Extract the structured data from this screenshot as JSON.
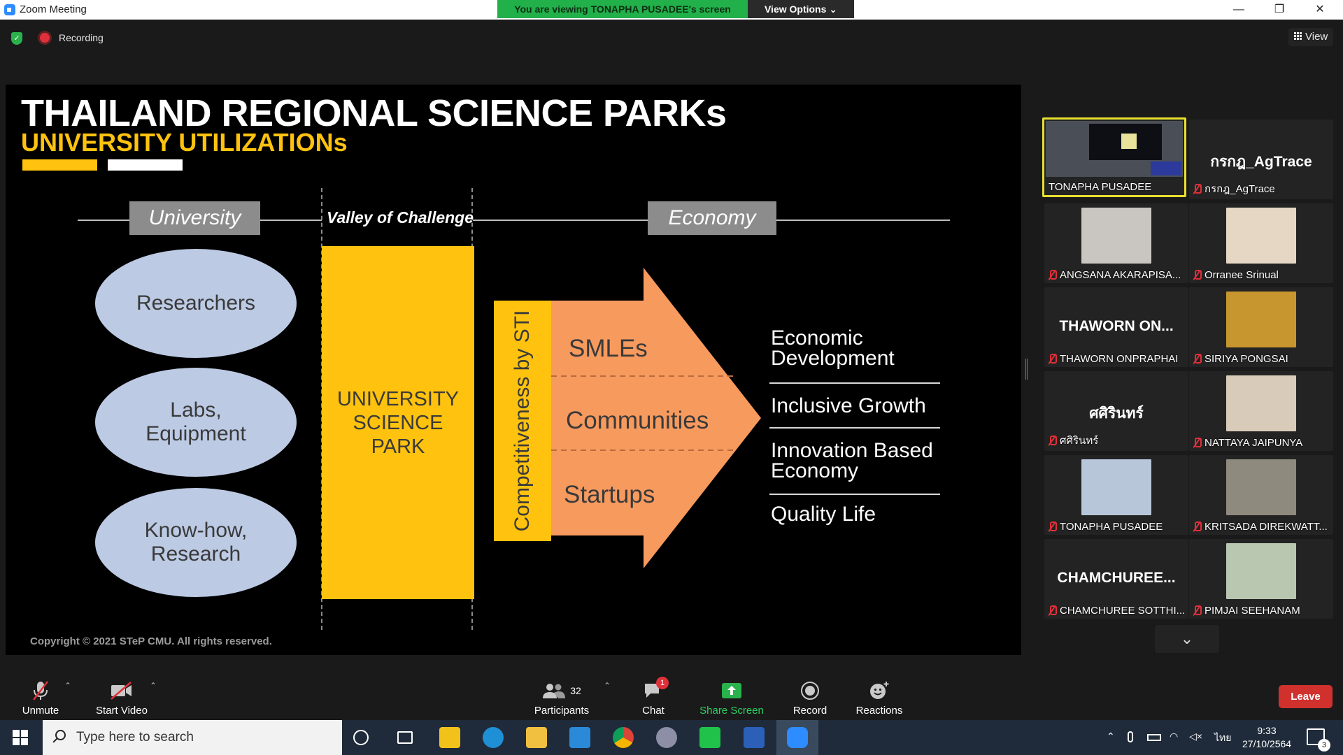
{
  "window": {
    "title": "Zoom Meeting",
    "viewing_banner": "You are viewing TONAPHA PUSADEE's screen",
    "view_options": "View Options ⌄",
    "minimize": "—",
    "restore": "❐",
    "close": "✕"
  },
  "top": {
    "recording": "Recording",
    "view": "View"
  },
  "slide": {
    "title": "THAILAND REGIONAL SCIENCE PARKs",
    "subtitle": "UNIVERSITY UTILIZATIONs",
    "university_tag": "University",
    "valley": "Valley of Challenge",
    "economy_tag": "Economy",
    "inputs": [
      "Researchers",
      "Labs,\nEquipment",
      "Know-how,\nResearch"
    ],
    "usp": "UNIVERSITY\nSCIENCE\nPARK",
    "competitiveness": "Competitiveness by STI",
    "arrow_items": [
      "SMLEs",
      "Communities",
      "Startups"
    ],
    "outcomes": [
      "Economic\nDevelopment",
      "Inclusive Growth",
      "Innovation Based\nEconomy",
      "Quality Life"
    ],
    "copyright": "Copyright © 2021 STeP CMU. All rights reserved.",
    "colors": {
      "accent_yellow": "#ffc20e",
      "arrow_orange": "#f79a5e",
      "ellipse_blue": "#bccae4"
    }
  },
  "participants_gallery": [
    {
      "label": "TONAPHA PUSADEE",
      "active": true,
      "muted": false,
      "video": "slide-thumb"
    },
    {
      "label": "กรกฎ_AgTrace",
      "big_name": "กรกฎ_AgTrace",
      "muted": true
    },
    {
      "label": "ANGSANA AKARAPISA...",
      "muted": true,
      "video": "#c9c6c2"
    },
    {
      "label": "Orranee Srinual",
      "muted": true,
      "video": "#e5d7c3"
    },
    {
      "label": "THAWORN ONPRAPHAI",
      "big_name": "THAWORN  ON...",
      "muted": true
    },
    {
      "label": "SIRIYA PONGSAI",
      "muted": true,
      "video": "#c7962f"
    },
    {
      "label": "ศศิรินทร์",
      "big_name": "ศศิรินทร์",
      "muted": true
    },
    {
      "label": "NATTAYA JAIPUNYA",
      "muted": true,
      "video": "#d9cbb9"
    },
    {
      "label": "TONAPHA PUSADEE",
      "muted": true,
      "video": "#b8c6da"
    },
    {
      "label": "KRITSADA DIREKWATT...",
      "muted": true,
      "video": "#8f8a7e"
    },
    {
      "label": "CHAMCHUREE SOTTHI...",
      "big_name": "CHAMCHUREE...",
      "muted": true
    },
    {
      "label": "PIMJAI SEEHANAM",
      "muted": true,
      "video": "#b9c6b0"
    }
  ],
  "toolbar": {
    "unmute": "Unmute",
    "start_video": "Start Video",
    "participants": "Participants",
    "participants_count": "32",
    "chat": "Chat",
    "chat_badge": "1",
    "share": "Share Screen",
    "record": "Record",
    "reactions": "Reactions",
    "leave": "Leave"
  },
  "taskbar": {
    "search_placeholder": "Type here to search",
    "lang": "ไทย",
    "time": "9:33",
    "date": "27/10/2564",
    "notif_count": "3"
  }
}
